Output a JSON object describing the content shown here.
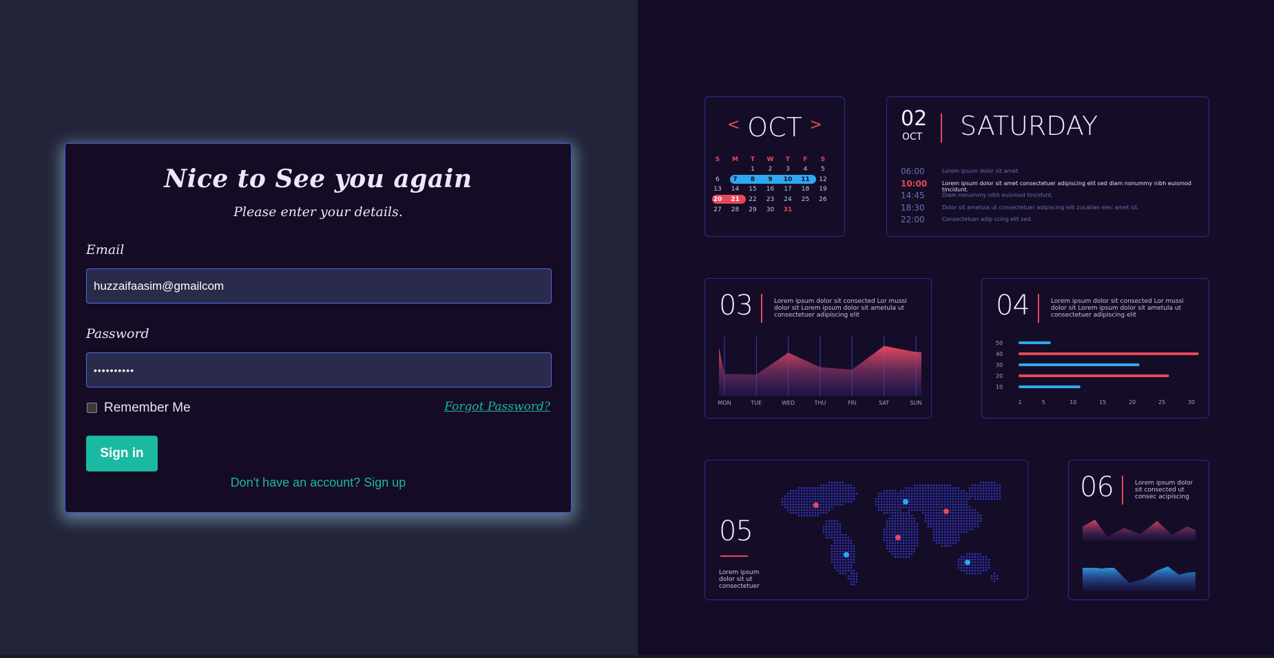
{
  "login": {
    "title": "Nice to See you again",
    "subtitle": "Please enter your details.",
    "email_label": "Email",
    "email_value": "huzzaifaasim@gmailcom",
    "password_label": "Password",
    "password_value": "••••••••••",
    "remember_label": "Remember Me",
    "remember_checked": false,
    "forgot_label": "Forgot Password?",
    "signin_label": "Sign in",
    "signup_label": "Don't have an account? Sign up"
  },
  "dashboard": {
    "calendar": {
      "month": "OCT",
      "prev": "<",
      "next": ">",
      "weekdays": [
        "S",
        "M",
        "T",
        "W",
        "T",
        "F",
        "S"
      ],
      "weeks": [
        [
          "",
          "",
          "1",
          "2",
          "3",
          "4",
          "5"
        ],
        [
          "6",
          "7",
          "8",
          "9",
          "10",
          "11",
          "12"
        ],
        [
          "13",
          "14",
          "15",
          "16",
          "17",
          "18",
          "19"
        ],
        [
          "20",
          "21",
          "22",
          "23",
          "24",
          "25",
          "26"
        ],
        [
          "27",
          "28",
          "29",
          "30",
          "31",
          "",
          ""
        ]
      ],
      "highlight_blue": [
        "7",
        "8",
        "9",
        "10",
        "11"
      ],
      "highlight_red": [
        "20",
        "21"
      ],
      "red_text": [
        "31"
      ]
    },
    "schedule": {
      "day_num": "02",
      "month": "OCT",
      "weekday": "SATURDAY",
      "entries": [
        {
          "time": "06:00",
          "text": "Lorem ipsum dolor sit amet."
        },
        {
          "time": "10:00",
          "text": "Lorem ipsum dolor sit amet consectetuer adipiscing elit sed diam nonummy nibh euismod tincidunt."
        },
        {
          "time": "14:45",
          "text": "Diam nonummy nibh euismod tincidunt."
        },
        {
          "time": "18:30",
          "text": "Dolor sit ametuia ut consectetuer adipiscing elit zucatian elec amet sit."
        },
        {
          "time": "22:00",
          "text": "Consectetuer adip scing elit sed."
        }
      ]
    },
    "panel03": {
      "num": "03",
      "text": "Lorem ipsum dolor sit consected Lor mussi dolor sit Lorem ipsum dolor sit ametula ut consectetuer adipiscing elit",
      "days": [
        "MON",
        "TUE",
        "WED",
        "THU",
        "FRI",
        "SAT",
        "SUN"
      ]
    },
    "panel04": {
      "num": "04",
      "text": "Lorem ipsum dolor sit consected Lor mussi dolor sit Lorem ipsum dolor sit ametula ut consectetuer adipiscing elit",
      "y_ticks": [
        "50",
        "40",
        "30",
        "20",
        "10"
      ],
      "x_ticks": [
        "1",
        "5",
        "10",
        "15",
        "20",
        "25",
        "30"
      ]
    },
    "panel05": {
      "num": "05",
      "text_lines": [
        "Lorem ipsum",
        "dolor sit ut",
        "consectetuer"
      ]
    },
    "panel06": {
      "num": "06",
      "text_lines": [
        "Lorem ipsum dolor",
        "sit consected ut",
        "consec acipiscing"
      ]
    },
    "colors": {
      "accent_red": "#e6495a",
      "accent_blue": "#2ea8f0",
      "teal": "#1ab9a2"
    }
  },
  "chart_data": [
    {
      "type": "area",
      "categories": [
        "MON",
        "TUE",
        "WED",
        "THU",
        "FRI",
        "SAT",
        "SUN"
      ],
      "values": [
        36,
        35,
        71,
        47,
        43,
        82,
        72
      ],
      "ylim": [
        0,
        100
      ]
    },
    {
      "type": "bar",
      "orientation": "horizontal",
      "categories": [
        "50",
        "40",
        "30",
        "20",
        "10"
      ],
      "values": [
        5,
        30,
        20,
        25,
        10
      ],
      "xlim": [
        1,
        30
      ],
      "colors": [
        "#2ea8f0",
        "#e6495a",
        "#2ea8f0",
        "#e6495a",
        "#2ea8f0"
      ]
    }
  ]
}
